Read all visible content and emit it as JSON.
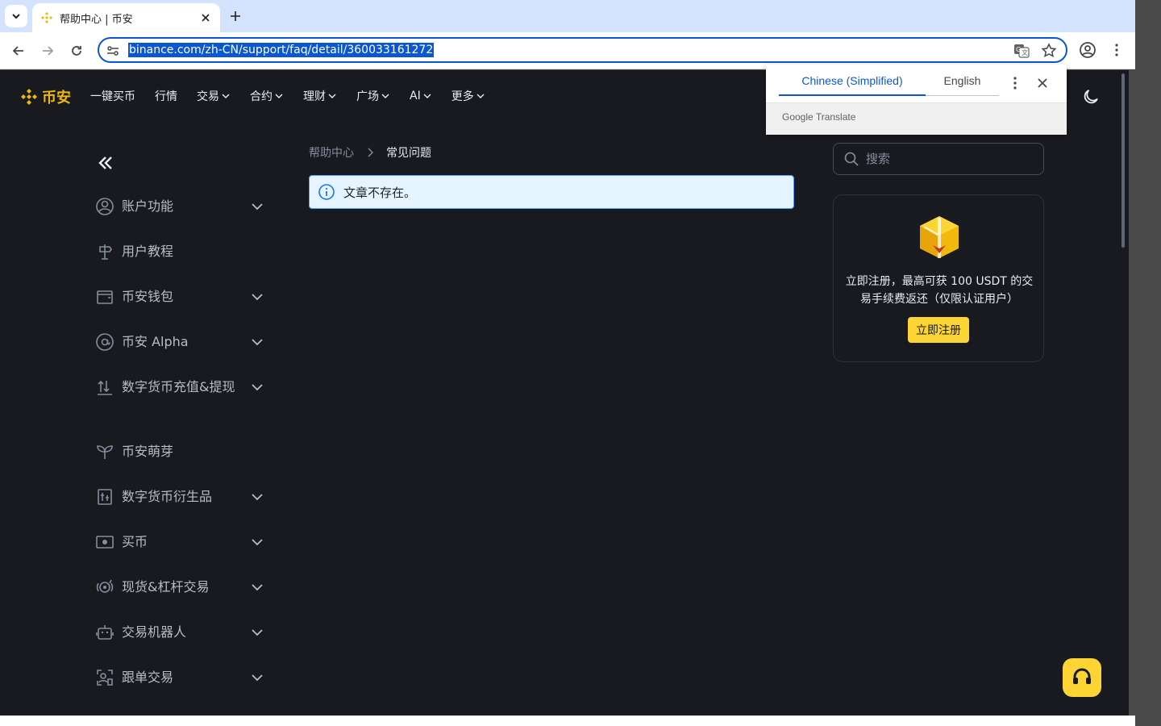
{
  "browser": {
    "tab_title": "帮助中心 | 币安",
    "url": "binance.com/zh-CN/support/faq/detail/360033161272"
  },
  "site": {
    "logo_text": "币安",
    "nav": [
      {
        "label": "一键买币",
        "has_menu": false
      },
      {
        "label": "行情",
        "has_menu": false
      },
      {
        "label": "交易",
        "has_menu": true
      },
      {
        "label": "合约",
        "has_menu": true
      },
      {
        "label": "理财",
        "has_menu": true
      },
      {
        "label": "广场",
        "has_menu": true
      },
      {
        "label": "AI",
        "has_menu": true
      },
      {
        "label": "更多",
        "has_menu": true
      }
    ]
  },
  "sidebar": {
    "items": [
      {
        "label": "账户功能",
        "icon": "user-circle-icon",
        "expandable": true
      },
      {
        "label": "用户教程",
        "icon": "signpost-icon",
        "expandable": false
      },
      {
        "label": "币安钱包",
        "icon": "wallet-icon",
        "expandable": true
      },
      {
        "label": "币安 Alpha",
        "icon": "at-sign-icon",
        "expandable": true
      },
      {
        "label": "数字货币充值&提现",
        "icon": "deposit-withdraw-icon",
        "expandable": true
      },
      {
        "label": "币安萌芽",
        "icon": "sprout-icon",
        "expandable": false
      },
      {
        "label": "数字货币衍生品",
        "icon": "derivatives-icon",
        "expandable": true
      },
      {
        "label": "买币",
        "icon": "cash-icon",
        "expandable": true
      },
      {
        "label": "现货&杠杆交易",
        "icon": "spot-margin-icon",
        "expandable": true
      },
      {
        "label": "交易机器人",
        "icon": "robot-icon",
        "expandable": true
      },
      {
        "label": "跟单交易",
        "icon": "copy-trading-icon",
        "expandable": true
      }
    ]
  },
  "main": {
    "breadcrumb": {
      "home": "帮助中心",
      "current": "常见问题"
    },
    "alert": "文章不存在。"
  },
  "right": {
    "search_placeholder": "搜索",
    "promo_text": "立即注册，最高可获 100 USDT 的交易手续费返还（仅限认证用户）",
    "promo_button": "立即注册"
  },
  "translate_popup": {
    "source_lang": "Chinese (Simplified)",
    "target_lang": "English",
    "footer": "Google Translate"
  },
  "colors": {
    "brand": "#f0b90b",
    "button_yellow": "#fcd535",
    "page_bg": "#181a20",
    "chrome_accent": "#0b57d0"
  }
}
